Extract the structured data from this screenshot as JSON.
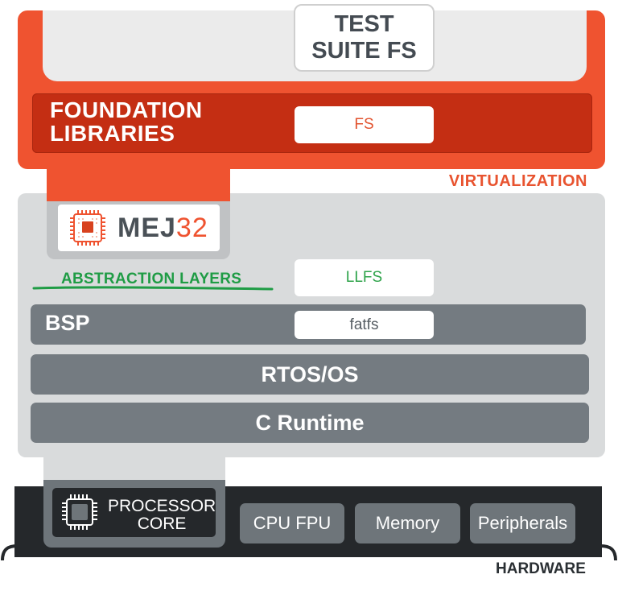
{
  "test_suite": {
    "line1": "TEST",
    "line2": "SUITE FS"
  },
  "foundation": {
    "line1": "FOUNDATION",
    "line2": "LIBRARIES",
    "fs_label": "FS"
  },
  "virtualization_label": "VIRTUALIZATION",
  "logo": {
    "text_bold": "MEJ",
    "text_thin": "32",
    "chip_label": "MEJ32"
  },
  "abstraction": {
    "label": "ABSTRACTION LAYERS",
    "llfs_label": "LLFS"
  },
  "bsp": {
    "label": "BSP",
    "fatfs_label": "fatfs"
  },
  "rtos_label": "RTOS/OS",
  "cruntime_label": "C Runtime",
  "hardware": {
    "processor_line1": "PROCESSOR",
    "processor_line2": "CORE",
    "cpu_fpu": "CPU FPU",
    "memory": "Memory",
    "peripherals": "Peripherals",
    "label": "HARDWARE"
  },
  "colors": {
    "accent_orange": "#ef5330",
    "foundation_red": "#c42e13",
    "abstraction_green": "#1f9c45",
    "layer_grey": "#747b81",
    "hardware_dark": "#25282b"
  },
  "icons": [
    "chip-icon",
    "processor-chip-icon"
  ]
}
